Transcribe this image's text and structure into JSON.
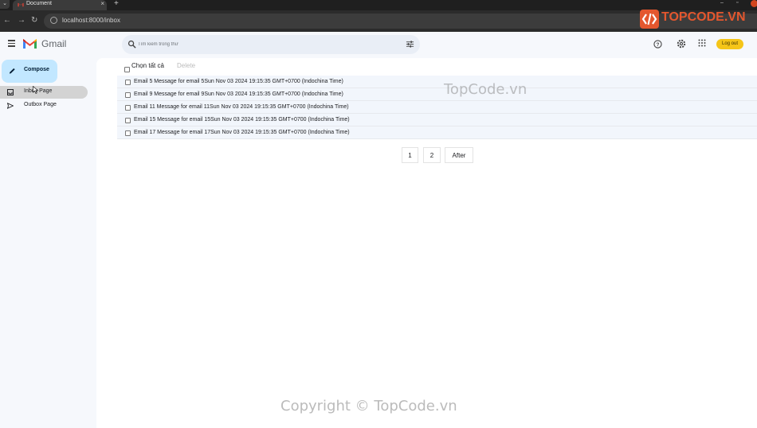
{
  "browser": {
    "tab_title": "Document",
    "tab_close": "×",
    "new_tab": "+",
    "url": "localhost:8000/inbox",
    "back": "←",
    "forward": "→",
    "reload": "↻",
    "minimize": "–",
    "restore": "▫"
  },
  "header": {
    "app_name": "Gmail",
    "search_placeholder": "Tìm kiếm trong thư",
    "logout_label": "Log out",
    "logout_color": "#f5c518"
  },
  "sidebar": {
    "compose_label": "Compose",
    "items": [
      {
        "label": "Inbox Page",
        "icon": "inbox-icon",
        "active": true
      },
      {
        "label": "Outbox Page",
        "icon": "send-icon",
        "active": false
      }
    ]
  },
  "toolbar": {
    "select_all_label": "Chọn tất cả",
    "delete_label": "Delete"
  },
  "emails": [
    {
      "text": "Email 5 Message for email 5Sun Nov 03 2024 19:15:35 GMT+0700 (Indochina Time)"
    },
    {
      "text": "Email 9 Message for email 9Sun Nov 03 2024 19:15:35 GMT+0700 (Indochina Time)"
    },
    {
      "text": "Email 11 Message for email 11Sun Nov 03 2024 19:15:35 GMT+0700 (Indochina Time)"
    },
    {
      "text": "Email 15 Message for email 15Sun Nov 03 2024 19:15:35 GMT+0700 (Indochina Time)"
    },
    {
      "text": "Email 17 Message for email 17Sun Nov 03 2024 19:15:35 GMT+0700 (Indochina Time)"
    }
  ],
  "pagination": {
    "pages": [
      "1",
      "2"
    ],
    "next_label": "After"
  },
  "watermarks": {
    "logo_text": "TOPCODE.VN",
    "center": "TopCode.vn",
    "bottom": "Copyright © TopCode.vn"
  }
}
